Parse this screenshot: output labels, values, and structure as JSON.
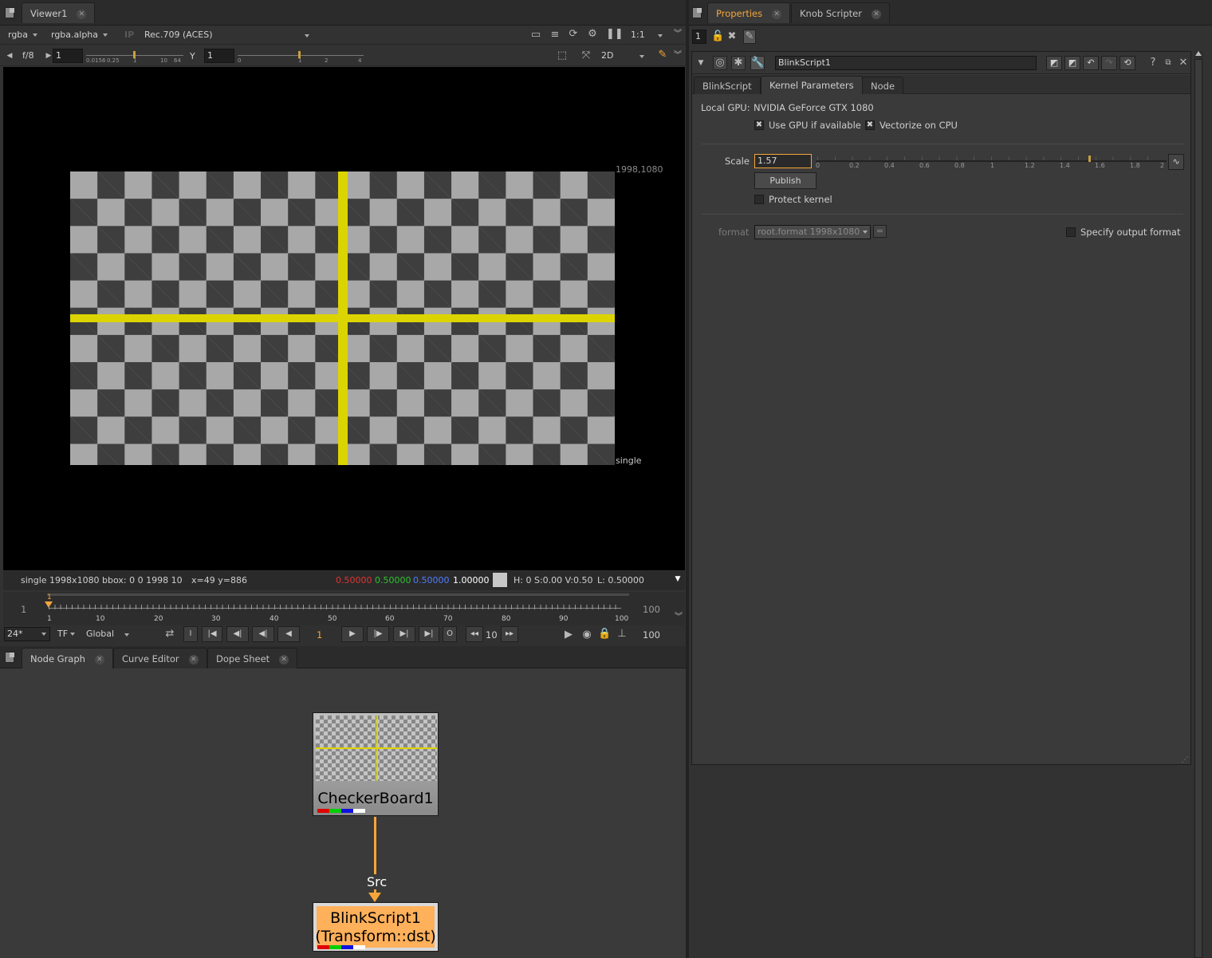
{
  "viewer_panel": {
    "tab_label": "Viewer1",
    "toolbar1": {
      "channels": "rgba",
      "alpha_channel": "rgba.alpha",
      "ip_label": "IP",
      "colorspace": "Rec.709 (ACES)",
      "zoom": "1:1"
    },
    "toolbar2": {
      "fstop": "f/8",
      "gain_value": "1",
      "gain_ticks": [
        "0.0156",
        "0.25",
        "1",
        "10",
        "64"
      ],
      "y_label": "Y",
      "gamma_value": "1",
      "gamma_ticks": [
        "0",
        "1",
        "2",
        "4"
      ],
      "view_mode": "2D"
    },
    "canvas": {
      "corner_label": "1998,1080",
      "format_label": "single"
    },
    "status": {
      "info": "single 1998x1080  bbox: 0 0 1998 10",
      "coords": "x=49 y=886",
      "r": "0.50000",
      "g": "0.50000",
      "b": "0.50000",
      "a": "1.00000",
      "hsv": "H:  0 S:0.00 V:0.50",
      "lum": "L: 0.50000"
    },
    "colors": {
      "red": "#e03434",
      "green": "#2fc22f",
      "blue": "#4f7cff",
      "accent": "#f5a53a",
      "overlay_yellow": "#dcd400"
    }
  },
  "timeline": {
    "start_frame": "1",
    "end_frame": "100",
    "current_frame_marker": "1",
    "tick_labels": [
      "1",
      "10",
      "20",
      "30",
      "40",
      "50",
      "60",
      "70",
      "80",
      "90",
      "100"
    ],
    "fps": "24*",
    "tf": "TF",
    "range_mode": "Global",
    "in_label": "I",
    "out_label": "O",
    "current_frame": "1",
    "step": "10",
    "end_value": "100"
  },
  "bottom_tabs": [
    "Node Graph",
    "Curve Editor",
    "Dope Sheet"
  ],
  "node_graph": {
    "node1_label": "CheckerBoard1",
    "edge_label": "Src",
    "node2_label_line1": "BlinkScript1",
    "node2_label_line2": "(Transform::dst)"
  },
  "properties": {
    "tabs": [
      "Properties",
      "Knob Scripter"
    ],
    "max_panels": "1",
    "node_name": "BlinkScript1",
    "sub_tabs": [
      "BlinkScript",
      "Kernel Parameters",
      "Node"
    ],
    "gpu_label": "Local GPU:",
    "gpu_value": "NVIDIA GeForce GTX 1080",
    "use_gpu_label": "Use GPU if available",
    "vectorize_label": "Vectorize on CPU",
    "scale_label": "Scale",
    "scale_value": "1.57",
    "scale_fraction": 0.785,
    "scale_ticks": [
      "0",
      "0.2",
      "0.4",
      "0.6",
      "0.8",
      "1",
      "1.2",
      "1.4",
      "1.6",
      "1.8",
      "2"
    ],
    "publish_label": "Publish",
    "protect_label": "Protect kernel",
    "format_label": "format",
    "format_value": "root.format 1998x1080",
    "equals_label": "=",
    "specify_label": "Specify output format",
    "help_label": "?"
  }
}
